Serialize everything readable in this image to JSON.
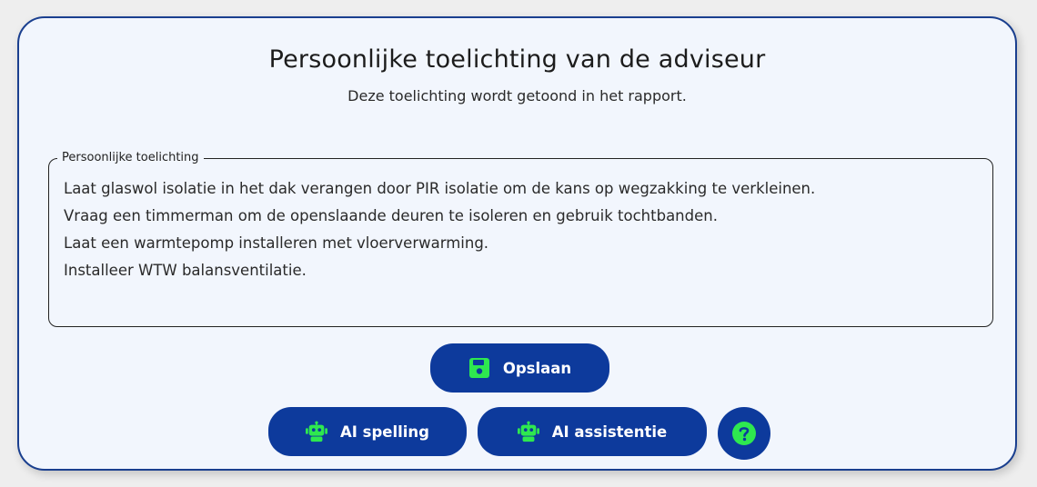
{
  "panel": {
    "title": "Persoonlijke toelichting van de adviseur",
    "subtitle": "Deze toelichting wordt getoond in het rapport."
  },
  "field": {
    "label": "Persoonlijke toelichting",
    "value": "Laat glaswol isolatie in het dak verangen door PIR isolatie om de kans op wegzakking te verkleinen.\nVraag een timmerman om de openslaande deuren te isoleren en gebruik tochtbanden.\nLaat een warmtepomp installeren met vloerverwarming.\nInstalleer WTW balansventilatie."
  },
  "actions": {
    "save_label": "Opslaan",
    "save_icon": "floppy-disk-icon",
    "spelling_label": "AI spelling",
    "spelling_icon": "robot-icon",
    "assist_label": "AI assistentie",
    "assist_icon": "robot-icon",
    "help_icon": "question-circle-icon"
  },
  "colors": {
    "button_bg": "#0d3a9c",
    "icon_accent": "#2ee84f",
    "card_border": "#1a3f8f",
    "card_bg": "#f2f6fd"
  }
}
